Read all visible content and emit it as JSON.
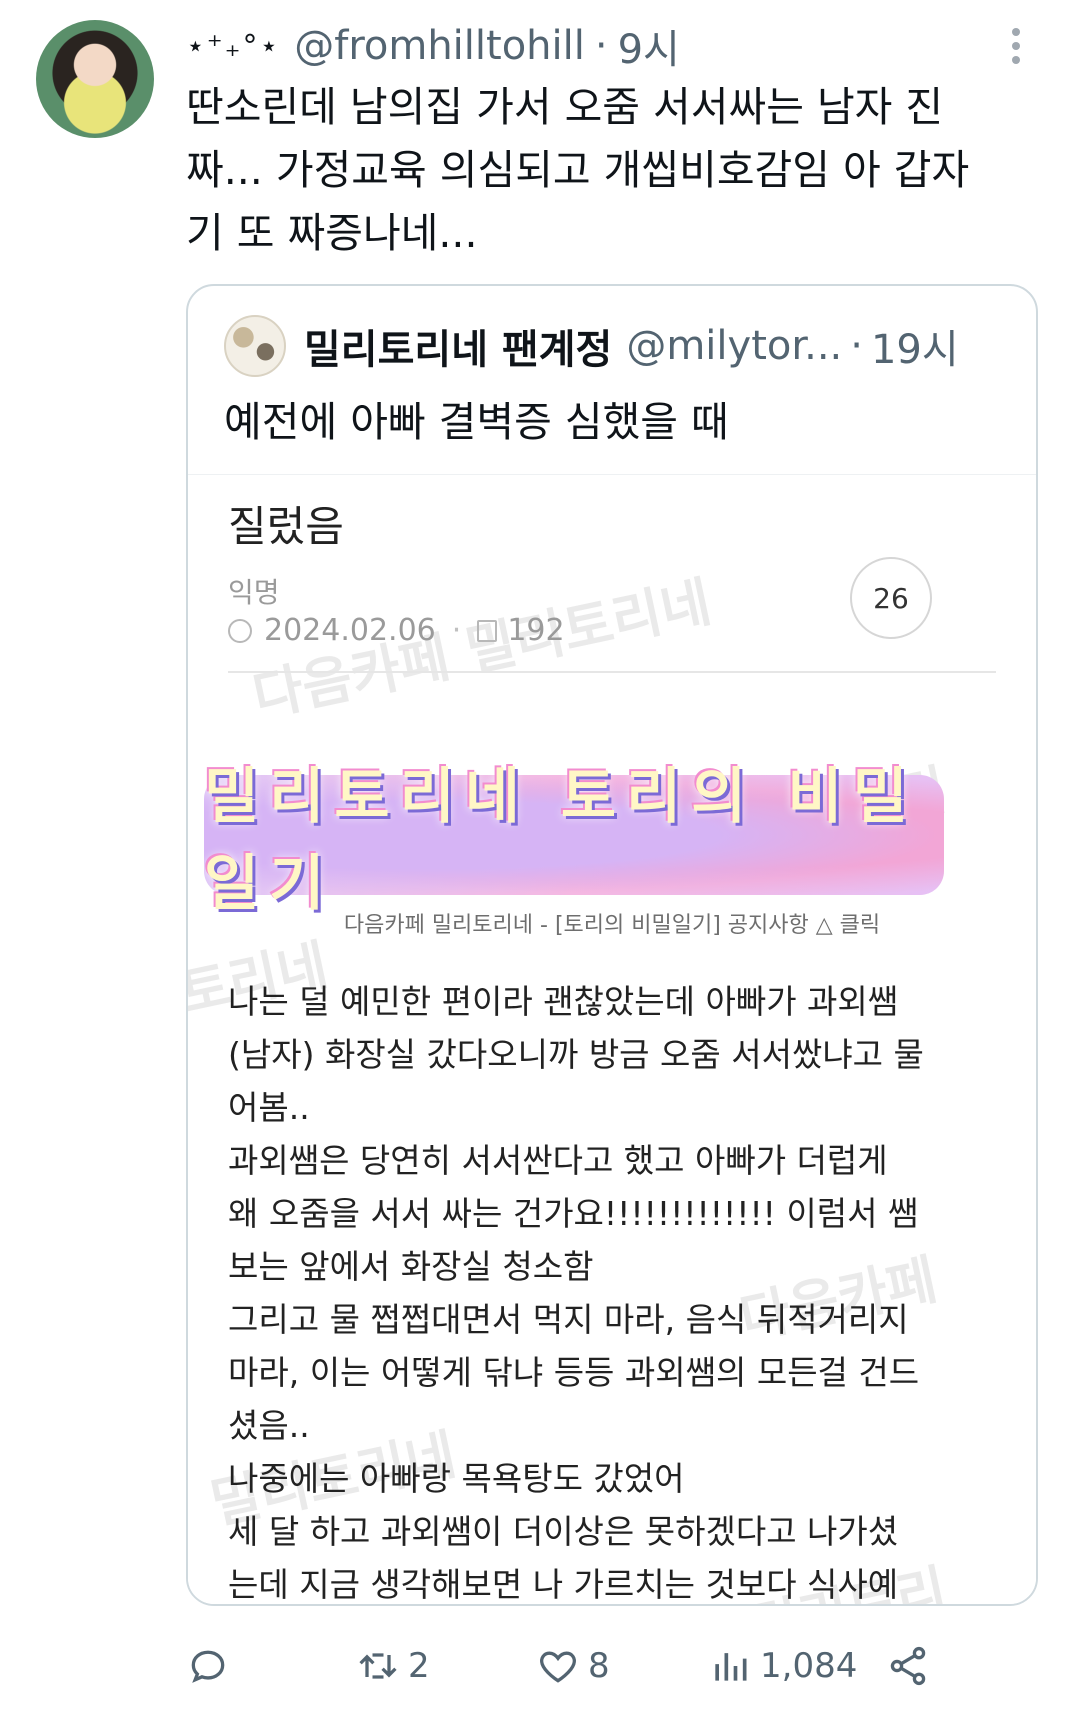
{
  "tweet": {
    "display_name": "⋆⁺₊°⋆",
    "handle": "@fromhilltohill",
    "separator": "·",
    "time": "9시",
    "text": "딴소린데 남의집 가서 오줌 서서싸는 남자 진짜... 가정교육 의심되고 개씹비호감임 아 갑자기 또 짜증나네..."
  },
  "quote": {
    "name": "밀리토리네 팬계정",
    "handle": "@milytor...",
    "separator": "·",
    "time": "19시",
    "text": "예전에 아빠 결벽증 심했을 때"
  },
  "post": {
    "title": "질렀음",
    "author": "익명",
    "date": "2024.02.06",
    "views": "192",
    "comments": "26",
    "banner_text": "밀리토리네 토리의 비밀일기",
    "banner_caption": "다음카페 밀리토리네 - [토리의 비밀일기] 공지사항 △ 클릭",
    "watermarks": [
      "다음카페 밀리토리네",
      "밀리토리",
      "토리네",
      "다음카페",
      "밀리토리네",
      "밀리토리"
    ],
    "body_lines": [
      "나는 덜 예민한 편이라 괜찮았는데 아빠가 과외쌤(남자) 화장실 갔다오니까 방금 오줌 서서쌌냐고 물어봄..",
      "과외쌤은 당연히 서서싼다고 했고 아빠가 더럽게 왜 오줌을 서서 싸는 건가요!!!!!!!!!!!!! 이럼서 쌤 보는 앞에서 화장실 청소함",
      "그리고 물 쩝쩝대면서 먹지 마라, 음식 뒤적거리지 마라, 이는 어떻게 닦냐 등등 과외쌤의 모든걸 건드셨음..",
      "나중에는 아빠랑 목욕탕도 갔었어",
      "세 달 하고 과외쌤이 더이상은 못하겠다고 나가셨는데 지금 생각해보면 나 가르치는 것보다 식사예절 배우고 갔도"
    ]
  },
  "actions": {
    "reply_count": "",
    "retweet_count": "2",
    "like_count": "8",
    "views_count": "1,084"
  }
}
